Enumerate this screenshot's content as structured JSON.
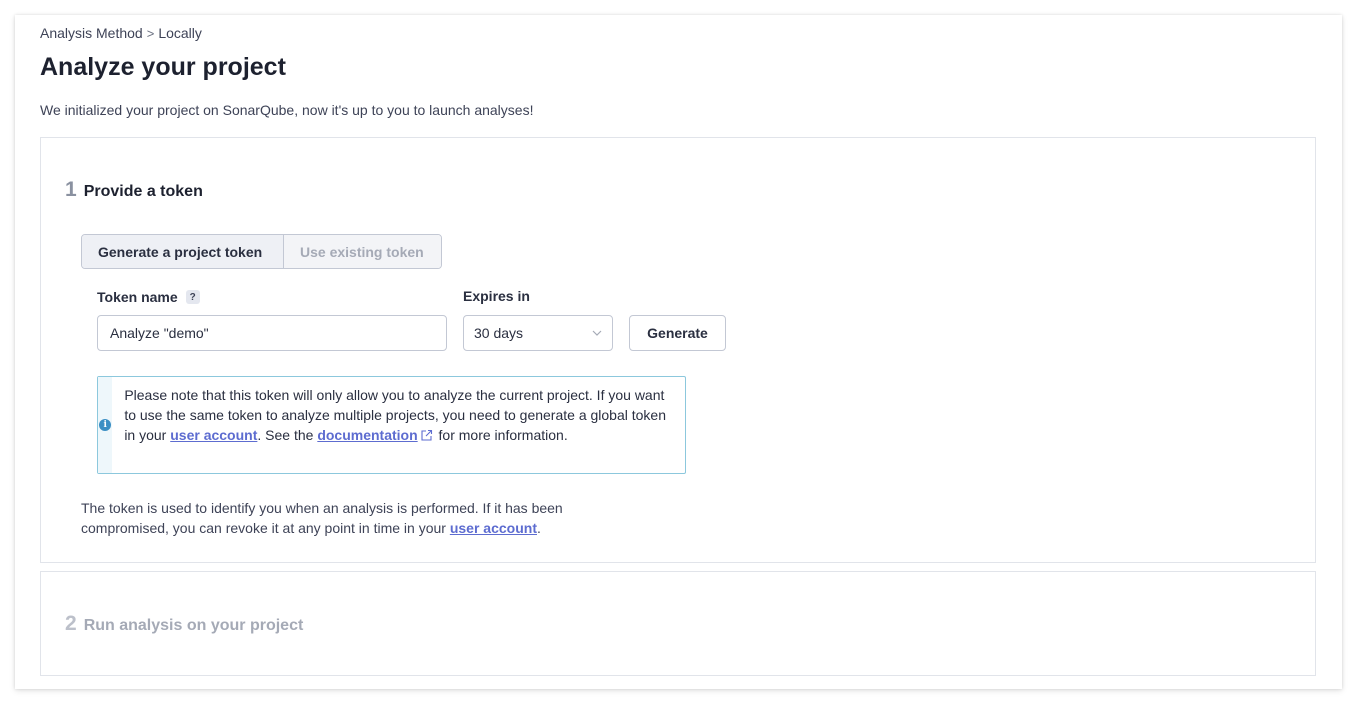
{
  "breadcrumb": {
    "parent": "Analysis Method",
    "separator": ">",
    "current": "Locally"
  },
  "page": {
    "title": "Analyze your project",
    "intro": "We initialized your project on SonarQube, now it's up to you to launch analyses!"
  },
  "step1": {
    "number": "1",
    "title": "Provide a token",
    "toggle": {
      "generate_label": "Generate a project token",
      "existing_label": "Use existing token"
    },
    "token_name_label": "Token name",
    "help_glyph": "?",
    "token_name_value": "Analyze \"demo\"",
    "expires_label": "Expires in",
    "expires_value": "30 days",
    "generate_button": "Generate",
    "alert": {
      "text1": "Please note that this token will only allow you to analyze the current project. If you want to use the same token to analyze multiple projects, you need to generate a global token in your ",
      "link1": "user account",
      "text2": ". See the ",
      "link2": "documentation",
      "text3": " for more information."
    },
    "note": {
      "text1": "The token is used to identify you when an analysis is performed. If it has been compromised, you can revoke it at any point in time in your ",
      "link": "user account",
      "text2": "."
    }
  },
  "step2": {
    "number": "2",
    "title": "Run analysis on your project"
  },
  "icons": {
    "info": "info-icon",
    "help": "question-icon",
    "external": "external-link-icon",
    "chevron": "chevron-down-icon"
  },
  "colors": {
    "link": "#5d6cd0",
    "alert_border": "#8cc8dd",
    "info": "#3b8fc4"
  }
}
